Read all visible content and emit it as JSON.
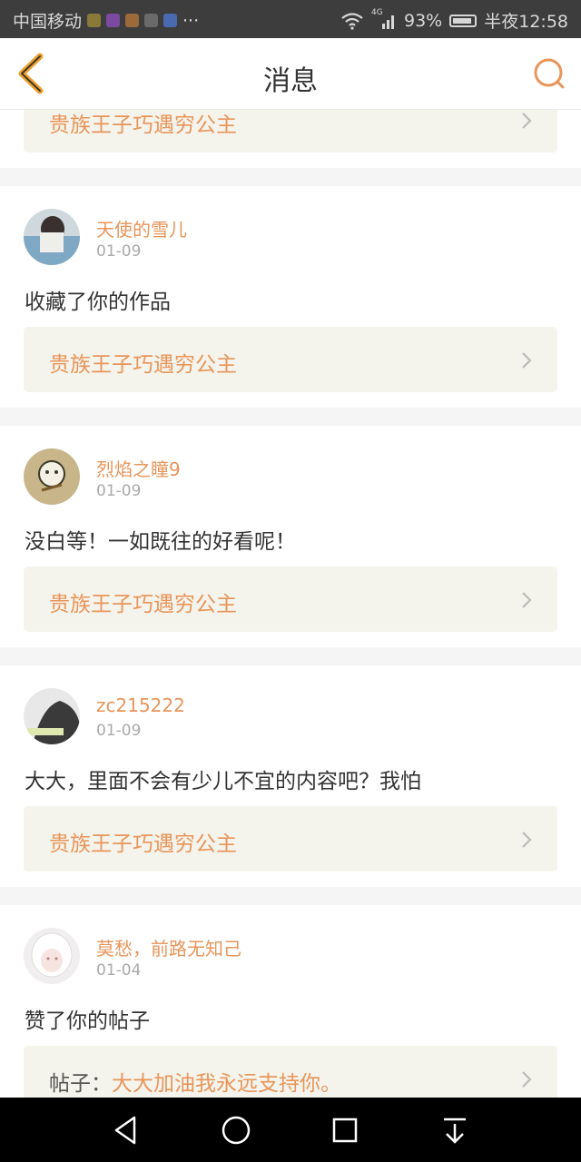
{
  "status_bar": {
    "carrier": "中国移动",
    "more": "···",
    "signal": "4G",
    "battery": "93%",
    "battery_level": 0.93,
    "time": "半夜12:58"
  },
  "header": {
    "title": "消息"
  },
  "top_partial_card": {
    "link_text": "贵族王子巧遇穷公主"
  },
  "messages": [
    {
      "user": "天使的雪儿",
      "date": "01-09",
      "text": "收藏了你的作品",
      "link_text": "贵族王子巧遇穷公主"
    },
    {
      "user": "烈焰之瞳9",
      "date": "01-09",
      "text": "没白等！一如既往的好看呢！",
      "link_text": "贵族王子巧遇穷公主"
    },
    {
      "user": "zc215222",
      "date": "01-09",
      "text": "大大，里面不会有少儿不宜的内容吧？我怕",
      "link_text": "贵族王子巧遇穷公主"
    },
    {
      "user": "莫愁，前路无知己",
      "date": "01-04",
      "text": "赞了你的帖子",
      "link_prefix": "帖子：",
      "link_text": "大大加油我永远支持你。"
    }
  ],
  "colors": {
    "accent": "#e8955a",
    "back_icon": "#f0a030",
    "status_bar": "#3d3d3d",
    "link_bg": "#f4f4ec"
  }
}
